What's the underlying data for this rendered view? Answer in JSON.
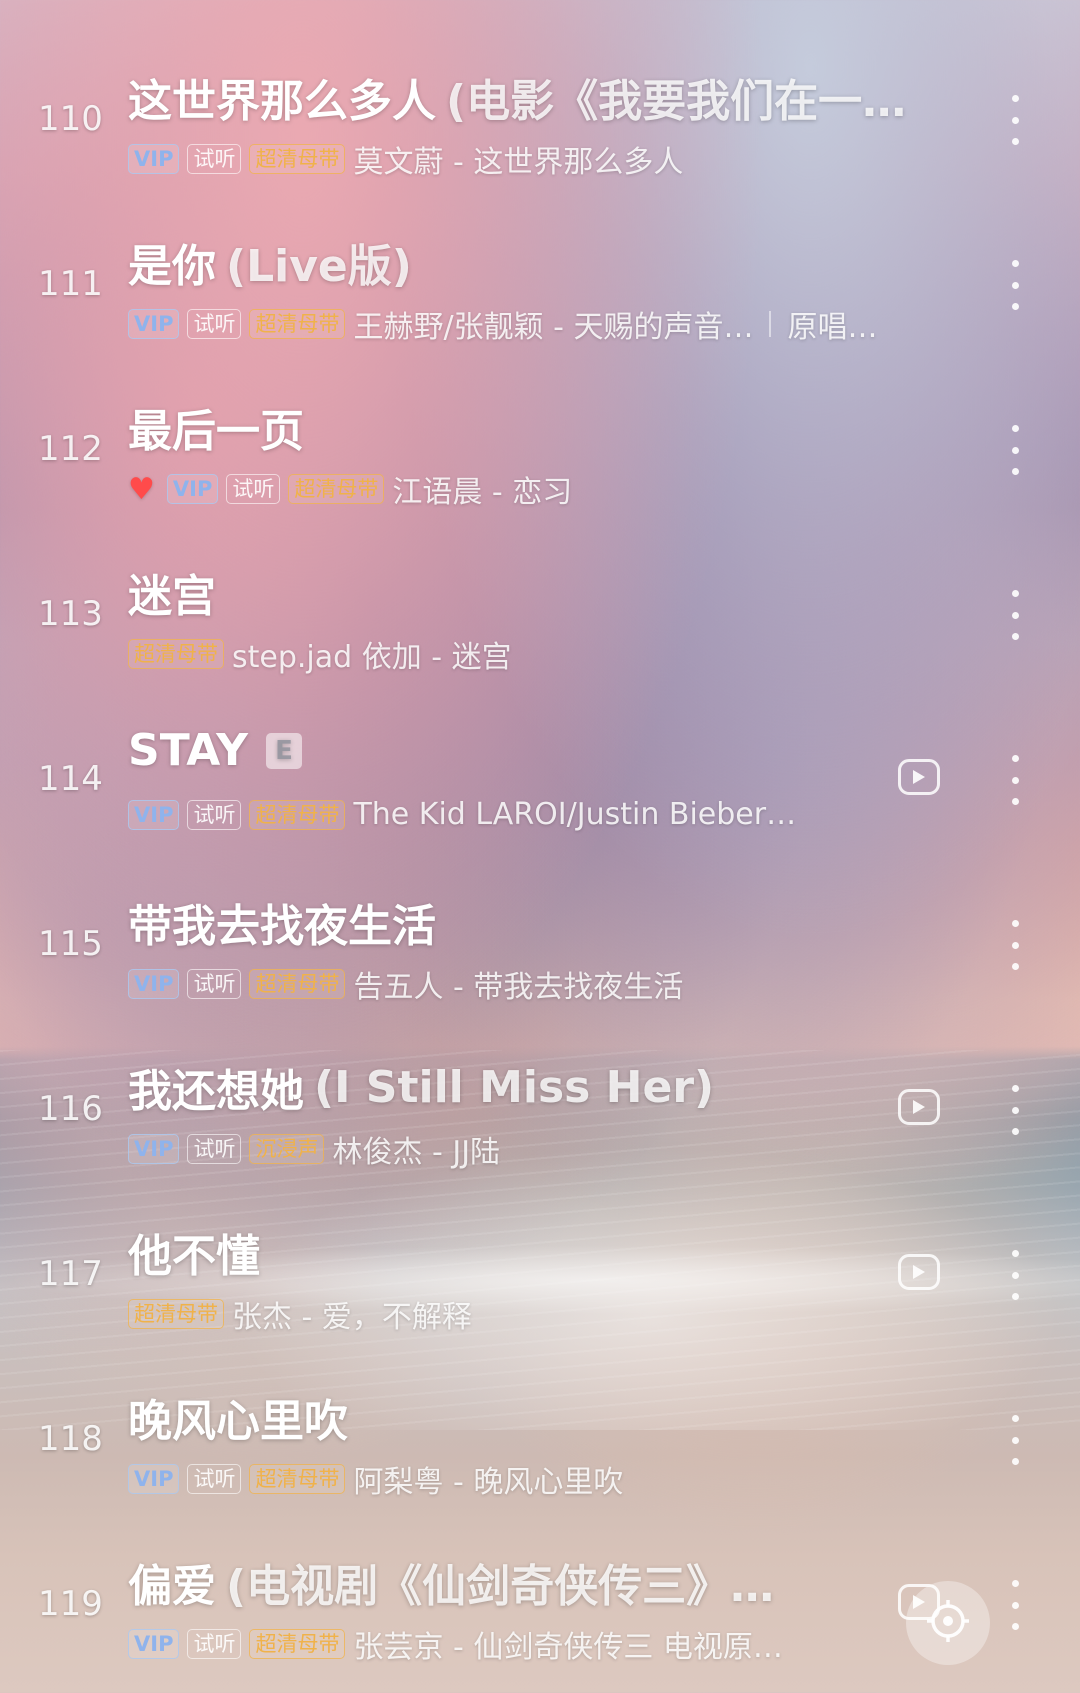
{
  "tags": {
    "vip": "VIP",
    "trial": "试听",
    "hq": "超清母带",
    "immersive": "沉浸声"
  },
  "explicit_label": "E",
  "icons": {
    "more": "more-vertical-icon",
    "mv": "play-video-icon",
    "heart": "heart-icon",
    "float": "locate-current-song-icon"
  },
  "colors": {
    "vip_tag": "#8fb3ec",
    "hq_tag": "#f0b24a",
    "heart": "#ff4b4b"
  },
  "songs": [
    {
      "index": "110",
      "title": "这世界那么多人",
      "title_extra": "(电影《我要我们在一…",
      "artist_album": "莫文蔚 - 这世界那么多人",
      "tags": [
        "vip",
        "trial",
        "hq"
      ],
      "mv": false,
      "liked": false,
      "explicit": false,
      "original": ""
    },
    {
      "index": "111",
      "title": "是你",
      "title_extra": "(Live版)",
      "artist_album": "王赫野/张靓颖 - 天赐的声音…",
      "tags": [
        "vip",
        "trial",
        "hq"
      ],
      "mv": false,
      "liked": false,
      "explicit": false,
      "original": "原唱…"
    },
    {
      "index": "112",
      "title": "最后一页",
      "title_extra": "",
      "artist_album": "江语晨 - 恋习",
      "tags": [
        "vip",
        "trial",
        "hq"
      ],
      "mv": false,
      "liked": true,
      "explicit": false,
      "original": ""
    },
    {
      "index": "113",
      "title": "迷宫",
      "title_extra": "",
      "artist_album": "step.jad 依加 - 迷宫",
      "tags": [
        "hq"
      ],
      "mv": false,
      "liked": false,
      "explicit": false,
      "original": ""
    },
    {
      "index": "114",
      "title": "STAY",
      "title_extra": "",
      "artist_album": "The Kid LAROI/Justin Bieber…",
      "tags": [
        "vip",
        "trial",
        "hq"
      ],
      "mv": true,
      "liked": false,
      "explicit": true,
      "original": ""
    },
    {
      "index": "115",
      "title": "带我去找夜生活",
      "title_extra": "",
      "artist_album": "告五人 - 带我去找夜生活",
      "tags": [
        "vip",
        "trial",
        "hq"
      ],
      "mv": false,
      "liked": false,
      "explicit": false,
      "original": ""
    },
    {
      "index": "116",
      "title": "我还想她",
      "title_extra": "(I Still Miss Her)",
      "artist_album": "林俊杰 - JJ陆",
      "tags": [
        "vip",
        "trial",
        "immersive"
      ],
      "mv": true,
      "liked": false,
      "explicit": false,
      "original": ""
    },
    {
      "index": "117",
      "title": "他不懂",
      "title_extra": "",
      "artist_album": "张杰 - 爱，不解释",
      "tags": [
        "hq"
      ],
      "mv": true,
      "liked": false,
      "explicit": false,
      "original": ""
    },
    {
      "index": "118",
      "title": "晚风心里吹",
      "title_extra": "",
      "artist_album": "阿梨粤 - 晚风心里吹",
      "tags": [
        "vip",
        "trial",
        "hq"
      ],
      "mv": false,
      "liked": false,
      "explicit": false,
      "original": ""
    },
    {
      "index": "119",
      "title": "偏爱",
      "title_extra": "(电视剧《仙剑奇侠传三》…",
      "artist_album": "张芸京 - 仙剑奇侠传三 电视原…",
      "tags": [
        "vip",
        "trial",
        "hq"
      ],
      "mv": true,
      "liked": false,
      "explicit": false,
      "original": ""
    }
  ]
}
